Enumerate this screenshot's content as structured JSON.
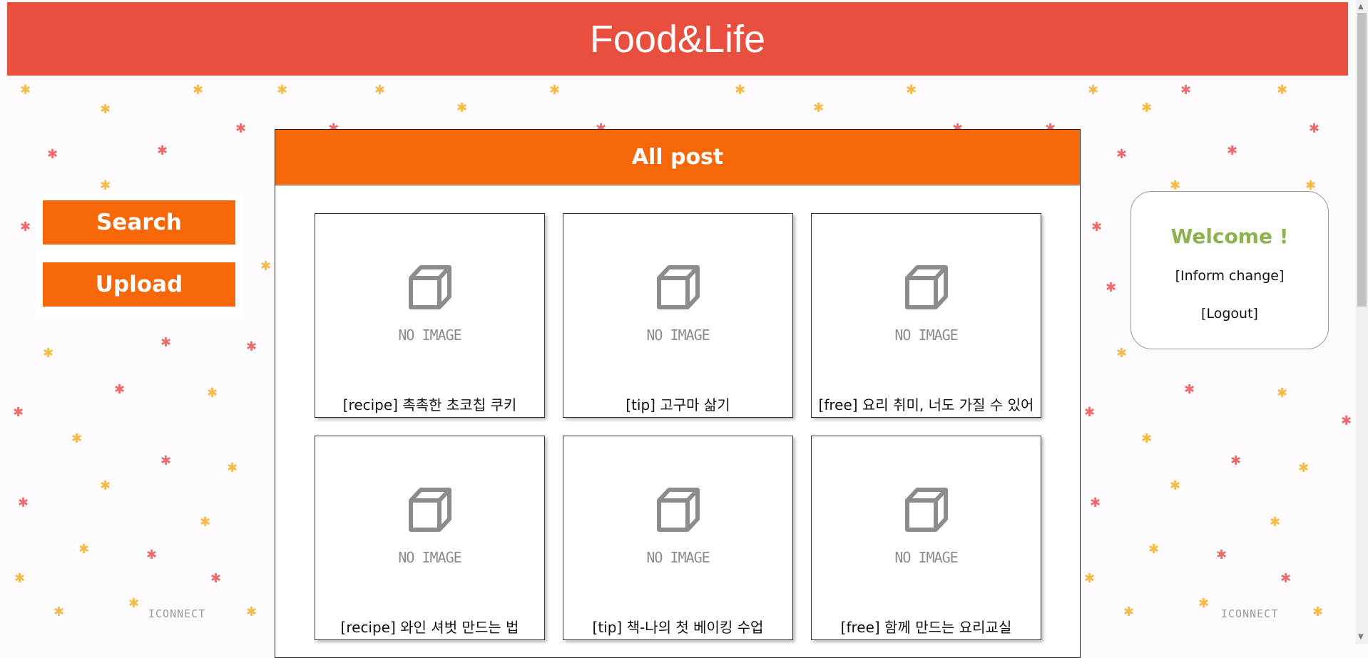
{
  "header": {
    "title": "Food&Life",
    "color": "#e84f3f"
  },
  "sidebar": {
    "search_label": "Search",
    "upload_label": "Upload",
    "button_color": "#f56708"
  },
  "main": {
    "heading": "All post",
    "placeholder_text": "NO IMAGE",
    "posts": [
      {
        "title": "[recipe] 촉촉한 초코칩 쿠키"
      },
      {
        "title": "[tip] 고구마 삶기"
      },
      {
        "title": "[free] 요리 취미, 너도 가질 수 있어"
      },
      {
        "title": "[recipe] 와인 셔벗 만드는 법"
      },
      {
        "title": "[tip] 책-나의 첫 베이킹 수업"
      },
      {
        "title": "[free] 함께 만드는 요리교실"
      }
    ]
  },
  "user_panel": {
    "welcome": "Welcome !",
    "inform_change": "[Inform change]",
    "logout": "[Logout]",
    "welcome_color": "#8db24f"
  },
  "watermarks": {
    "left": "ICONNECT",
    "right": "ICONNECT"
  },
  "icons": {
    "placeholder": "cube-icon",
    "leaf": "maple-leaf-icon"
  }
}
